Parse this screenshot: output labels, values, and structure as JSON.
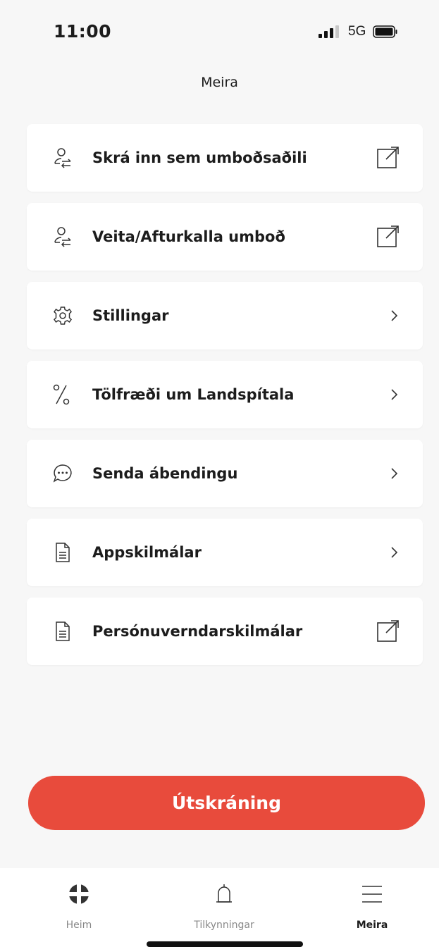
{
  "status": {
    "time": "11:00",
    "network": "5G"
  },
  "header": {
    "title": "Meira"
  },
  "menu": [
    {
      "label": "Skrá inn sem umboðsaðili",
      "icon": "user-switch-icon",
      "trail": "external-link-icon"
    },
    {
      "label": "Veita/Afturkalla umboð",
      "icon": "user-switch-icon",
      "trail": "external-link-icon"
    },
    {
      "label": "Stillingar",
      "icon": "gear-icon",
      "trail": "chevron-right-icon"
    },
    {
      "label": "Tölfræði um Landspítala",
      "icon": "percent-icon",
      "trail": "chevron-right-icon"
    },
    {
      "label": "Senda ábendingu",
      "icon": "chat-bubble-icon",
      "trail": "chevron-right-icon"
    },
    {
      "label": "Appskilmálar",
      "icon": "document-icon",
      "trail": "chevron-right-icon"
    },
    {
      "label": "Persónuverndarskilmálar",
      "icon": "document-icon",
      "trail": "external-link-icon"
    }
  ],
  "logout": {
    "label": "Útskráning",
    "color": "#e84b3c"
  },
  "tabs": [
    {
      "label": "Heim",
      "icon": "home-cross-icon",
      "active": false
    },
    {
      "label": "Tilkynningar",
      "icon": "bell-icon",
      "active": false
    },
    {
      "label": "Meira",
      "icon": "menu-icon",
      "active": true
    }
  ]
}
